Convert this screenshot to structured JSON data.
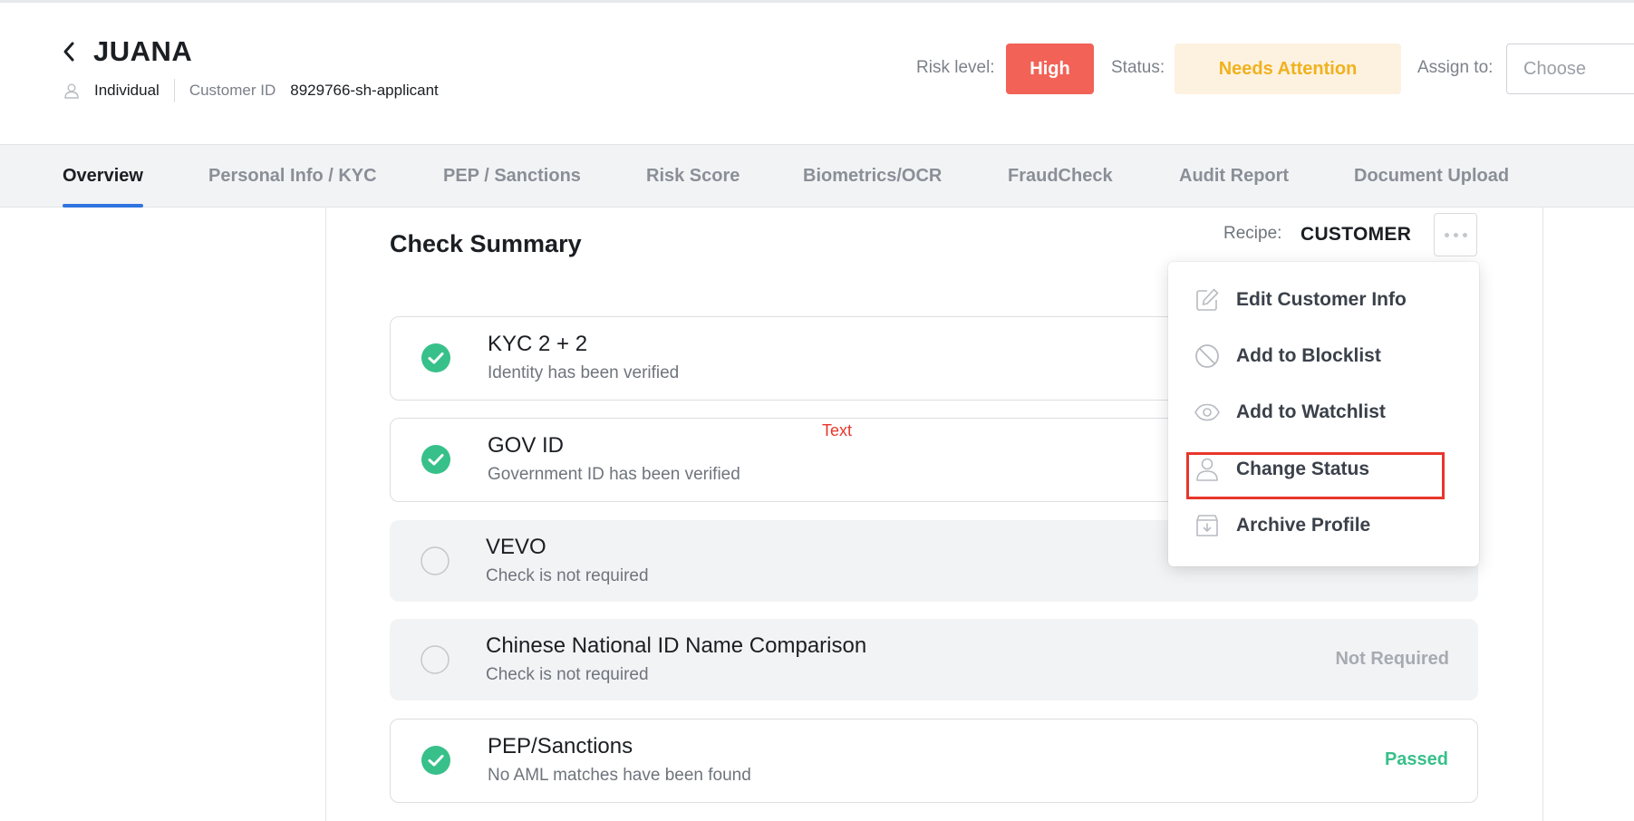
{
  "header": {
    "name": "JUANA",
    "entity_type": "Individual",
    "customer_id_label": "Customer ID",
    "customer_id": "8929766-sh-applicant",
    "risk_label": "Risk level:",
    "risk_value": "High",
    "status_label": "Status:",
    "status_value": "Needs Attention",
    "assign_label": "Assign to:",
    "assign_placeholder": "Choose"
  },
  "tabs": [
    {
      "label": "Overview",
      "active": true
    },
    {
      "label": "Personal Info / KYC"
    },
    {
      "label": "PEP / Sanctions"
    },
    {
      "label": "Risk Score"
    },
    {
      "label": "Biometrics/OCR"
    },
    {
      "label": "FraudCheck"
    },
    {
      "label": "Audit Report"
    },
    {
      "label": "Document Upload"
    }
  ],
  "summary": {
    "title": "Check Summary",
    "recipe_label": "Recipe:",
    "recipe_value": "CUSTOMER"
  },
  "checks": [
    {
      "title": "KYC 2 + 2",
      "subtitle": "Identity has been verified",
      "state": "passed",
      "status": ""
    },
    {
      "title": "GOV ID",
      "subtitle": "Government ID has been verified",
      "state": "passed",
      "status": ""
    },
    {
      "title": "VEVO",
      "subtitle": "Check is not required",
      "state": "not-required",
      "status": ""
    },
    {
      "title": "Chinese National ID Name Comparison",
      "subtitle": "Check is not required",
      "state": "not-required",
      "status": "Not Required"
    },
    {
      "title": "PEP/Sanctions",
      "subtitle": "No AML matches have been found",
      "state": "passed",
      "status": "Passed"
    }
  ],
  "annotation": "Text",
  "menu": {
    "items": [
      {
        "label": "Edit Customer Info",
        "icon": "edit-icon"
      },
      {
        "label": "Add to Blocklist",
        "icon": "block-icon"
      },
      {
        "label": "Add to Watchlist",
        "icon": "eye-icon"
      },
      {
        "label": "Change Status",
        "icon": "user-icon",
        "highlighted": true
      },
      {
        "label": "Archive Profile",
        "icon": "archive-icon"
      }
    ]
  },
  "colors": {
    "risk_high": "#f26257",
    "status_attention_bg": "#fdf1e0",
    "status_attention_text": "#f0b21c",
    "passed": "#38c08a",
    "tab_active_underline": "#2f74e0",
    "highlight": "#e8362b"
  }
}
